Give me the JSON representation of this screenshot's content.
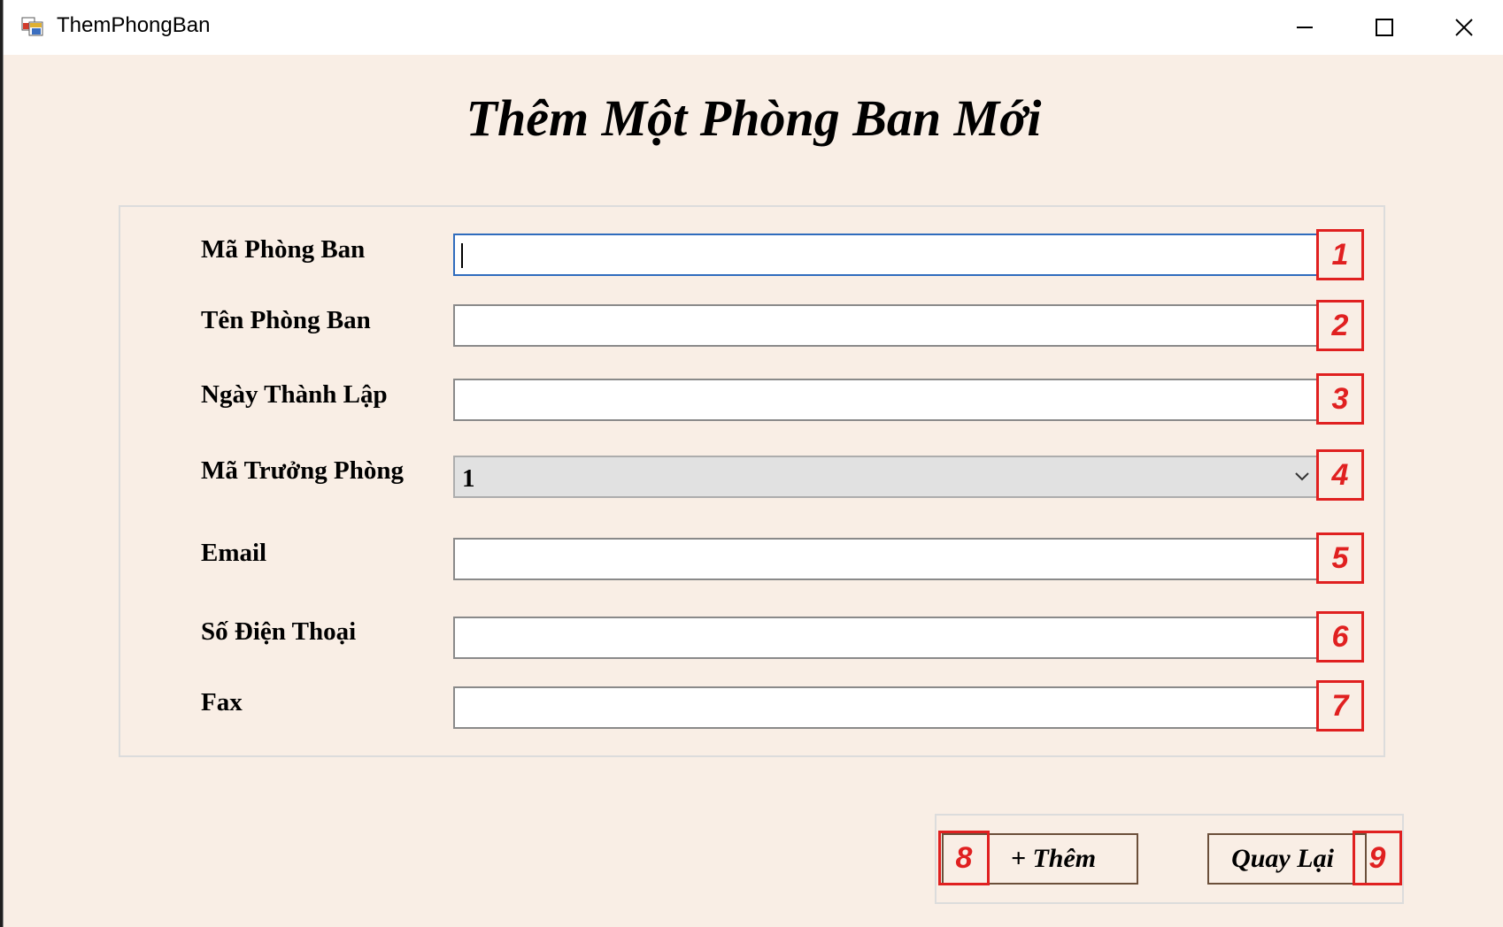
{
  "window": {
    "title": "ThemPhongBan",
    "controls": [
      "minimize",
      "maximize",
      "close"
    ]
  },
  "form": {
    "heading": "Thêm Một Phòng Ban Mới",
    "fields": [
      {
        "label": "Mã Phòng Ban",
        "value": "",
        "marker": "1",
        "type": "text",
        "focused": true
      },
      {
        "label": "Tên Phòng Ban",
        "value": "",
        "marker": "2",
        "type": "text"
      },
      {
        "label": "Ngày Thành Lập",
        "value": "",
        "marker": "3",
        "type": "text"
      },
      {
        "label": "Mã Trưởng Phòng",
        "value": "1",
        "marker": "4",
        "type": "combobox"
      },
      {
        "label": "Email",
        "value": "",
        "marker": "5",
        "type": "text"
      },
      {
        "label": "Số Điện Thoại",
        "value": "",
        "marker": "6",
        "type": "text"
      },
      {
        "label": "Fax",
        "value": "",
        "marker": "7",
        "type": "text"
      }
    ]
  },
  "buttons": {
    "add": {
      "label": "+ Thêm",
      "marker": "8"
    },
    "back": {
      "label": "Quay Lại",
      "marker": "9"
    }
  },
  "colors": {
    "background": "#f9eee5",
    "marker": "#e02020",
    "focus_border": "#2f6cbd"
  }
}
